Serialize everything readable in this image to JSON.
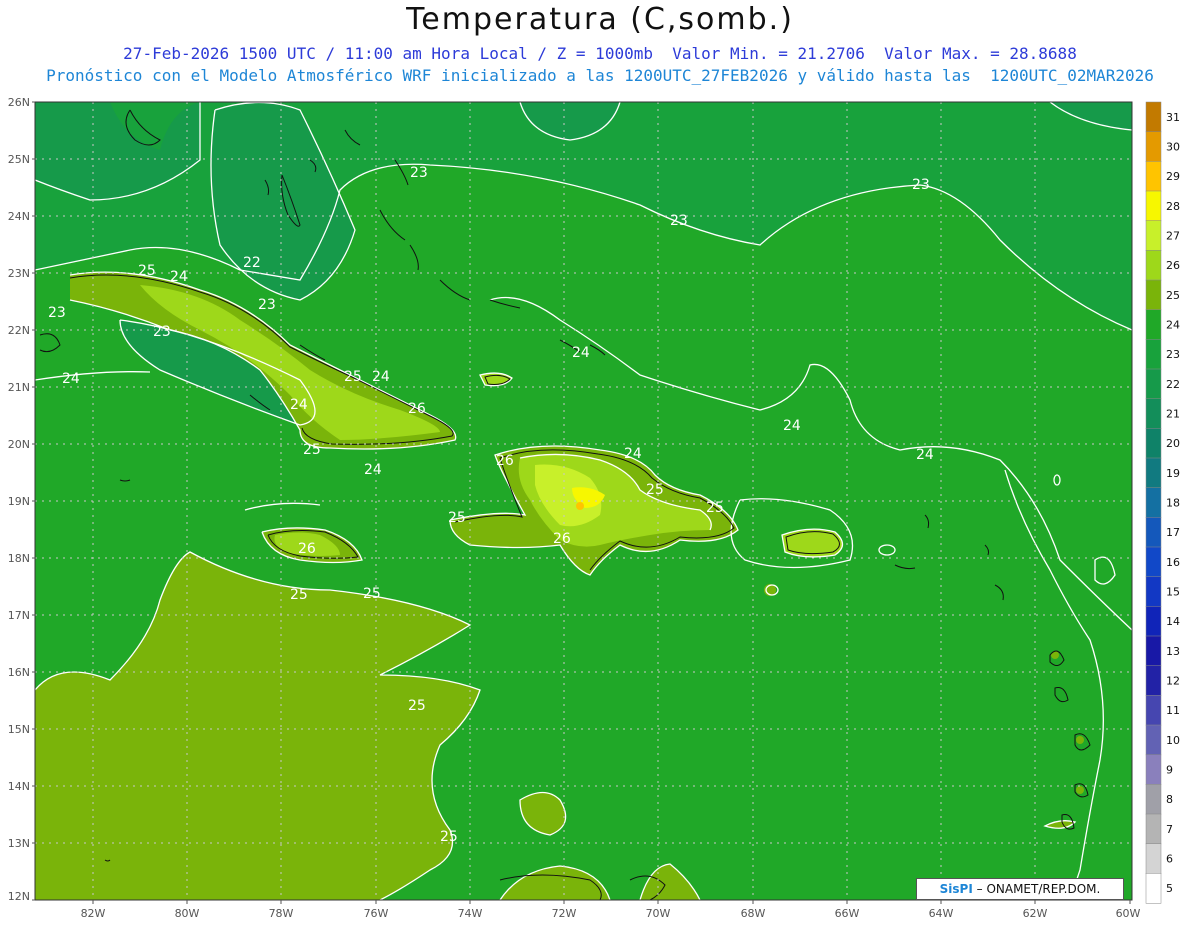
{
  "title": "Temperatura (C,somb.)",
  "subtitle_line1": "27-Feb-2026 1500 UTC / 11:00 am Hora Local / Z = 1000mb  Valor Min. = 21.2706  Valor Max. = 28.8688",
  "subtitle_line2": "Pronóstico con el Modelo Atmosférico WRF inicializado a las 1200UTC_27FEB2026 y válido hasta las  1200UTC_02MAR2026",
  "credit": {
    "brand": "SisPI",
    "text": " – ONAMET/REP.DOM."
  },
  "lat_labels": [
    "26N",
    "25N",
    "24N",
    "23N",
    "22N",
    "21N",
    "20N",
    "19N",
    "18N",
    "17N",
    "16N",
    "15N",
    "14N",
    "13N",
    "12N"
  ],
  "lon_labels": [
    "82W",
    "80W",
    "78W",
    "76W",
    "74W",
    "72W",
    "70W",
    "68W",
    "66W",
    "64W",
    "62W",
    "60W"
  ],
  "colorbar": {
    "levels": [
      "31",
      "30",
      "29",
      "28",
      "27",
      "26",
      "25",
      "24",
      "23",
      "22",
      "21",
      "20",
      "19",
      "18",
      "17",
      "16",
      "15",
      "14",
      "13",
      "12",
      "11",
      "10",
      "9",
      "8",
      "7",
      "6",
      "5"
    ],
    "colors": [
      "#c27a00",
      "#e49a00",
      "#ffc400",
      "#f7f700",
      "#c8f02a",
      "#9ed81a",
      "#7ab40a",
      "#20a828",
      "#18a23c",
      "#169a4a",
      "#138e5a",
      "#0f8268",
      "#117a80",
      "#1470a2",
      "#1458bb",
      "#1148c8",
      "#1238c4",
      "#1024b8",
      "#1818a6",
      "#2222a6",
      "#4646b0",
      "#6262b4",
      "#8a80bc",
      "#a0a0a8",
      "#b4b4b4",
      "#d4d4d4",
      "#ffffff"
    ]
  },
  "contour_labels": [
    "23",
    "23",
    "23",
    "22",
    "25",
    "24",
    "23",
    "23",
    "23",
    "24",
    "24",
    "25",
    "24",
    "24",
    "26",
    "25",
    "24",
    "24",
    "24",
    "26",
    "24",
    "25",
    "25",
    "25",
    "26",
    "26",
    "25",
    "25",
    "25",
    "25"
  ]
}
